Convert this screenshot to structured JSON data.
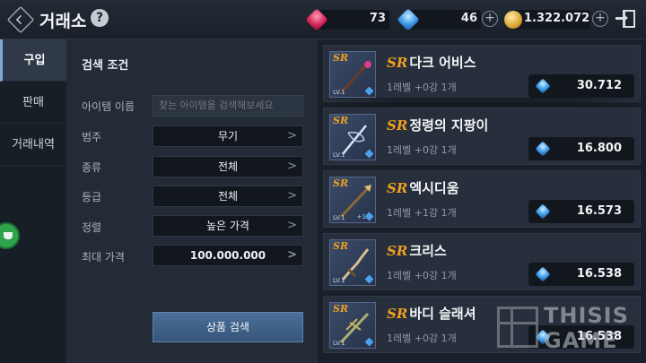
{
  "header": {
    "title": "거래소",
    "help_label": "?",
    "ruby_amount": "73",
    "gem_amount": "46",
    "gold_amount": "1.322.072",
    "plus_label": "+"
  },
  "nav": {
    "items": [
      {
        "label": "구입",
        "active": true
      },
      {
        "label": "판매",
        "active": false
      },
      {
        "label": "거래내역",
        "active": false
      }
    ]
  },
  "filter": {
    "section_title": "검색 조건",
    "item_name_label": "아이템 이름",
    "search_placeholder": "찾는 아이템을 검색해보세요",
    "category_label": "범주",
    "category_value": "무기",
    "type_label": "종류",
    "type_value": "전체",
    "grade_label": "등급",
    "grade_value": "전체",
    "sort_label": "정렬",
    "sort_value": "높은 가격",
    "max_price_label": "최대 가격",
    "max_price_value": "100.000.000",
    "search_button": "상품 검색",
    "chevron": ">"
  },
  "items": [
    {
      "grade": "SR",
      "name": "다크 어비스",
      "level": "1레벨",
      "enhance": "+0강",
      "count": "1개",
      "price": "30.712",
      "lv_badge": "LV.1"
    },
    {
      "grade": "SR",
      "name": "정령의 지팡이",
      "level": "1레벨",
      "enhance": "+0강",
      "count": "1개",
      "price": "16.800",
      "lv_badge": "LV.1"
    },
    {
      "grade": "SR",
      "name": "엑시디움",
      "level": "1레벨",
      "enhance": "+1강",
      "count": "1개",
      "price": "16.573",
      "lv_badge": "LV.1",
      "plus_badge": "+1"
    },
    {
      "grade": "SR",
      "name": "크리스",
      "level": "1레벨",
      "enhance": "+0강",
      "count": "1개",
      "price": "16.538",
      "lv_badge": "LV.1"
    },
    {
      "grade": "SR",
      "name": "바디 슬래셔",
      "level": "1레벨",
      "enhance": "+0강",
      "count": "1개",
      "price": "16.538",
      "lv_badge": "LV.1"
    }
  ],
  "watermark": {
    "line1": "THISIS",
    "line2": "GAME"
  },
  "colors": {
    "accent_orange": "#f0a020",
    "button_blue": "#4a6f98",
    "gem_blue": "#3d9ae8",
    "ruby_red": "#d2245a"
  }
}
